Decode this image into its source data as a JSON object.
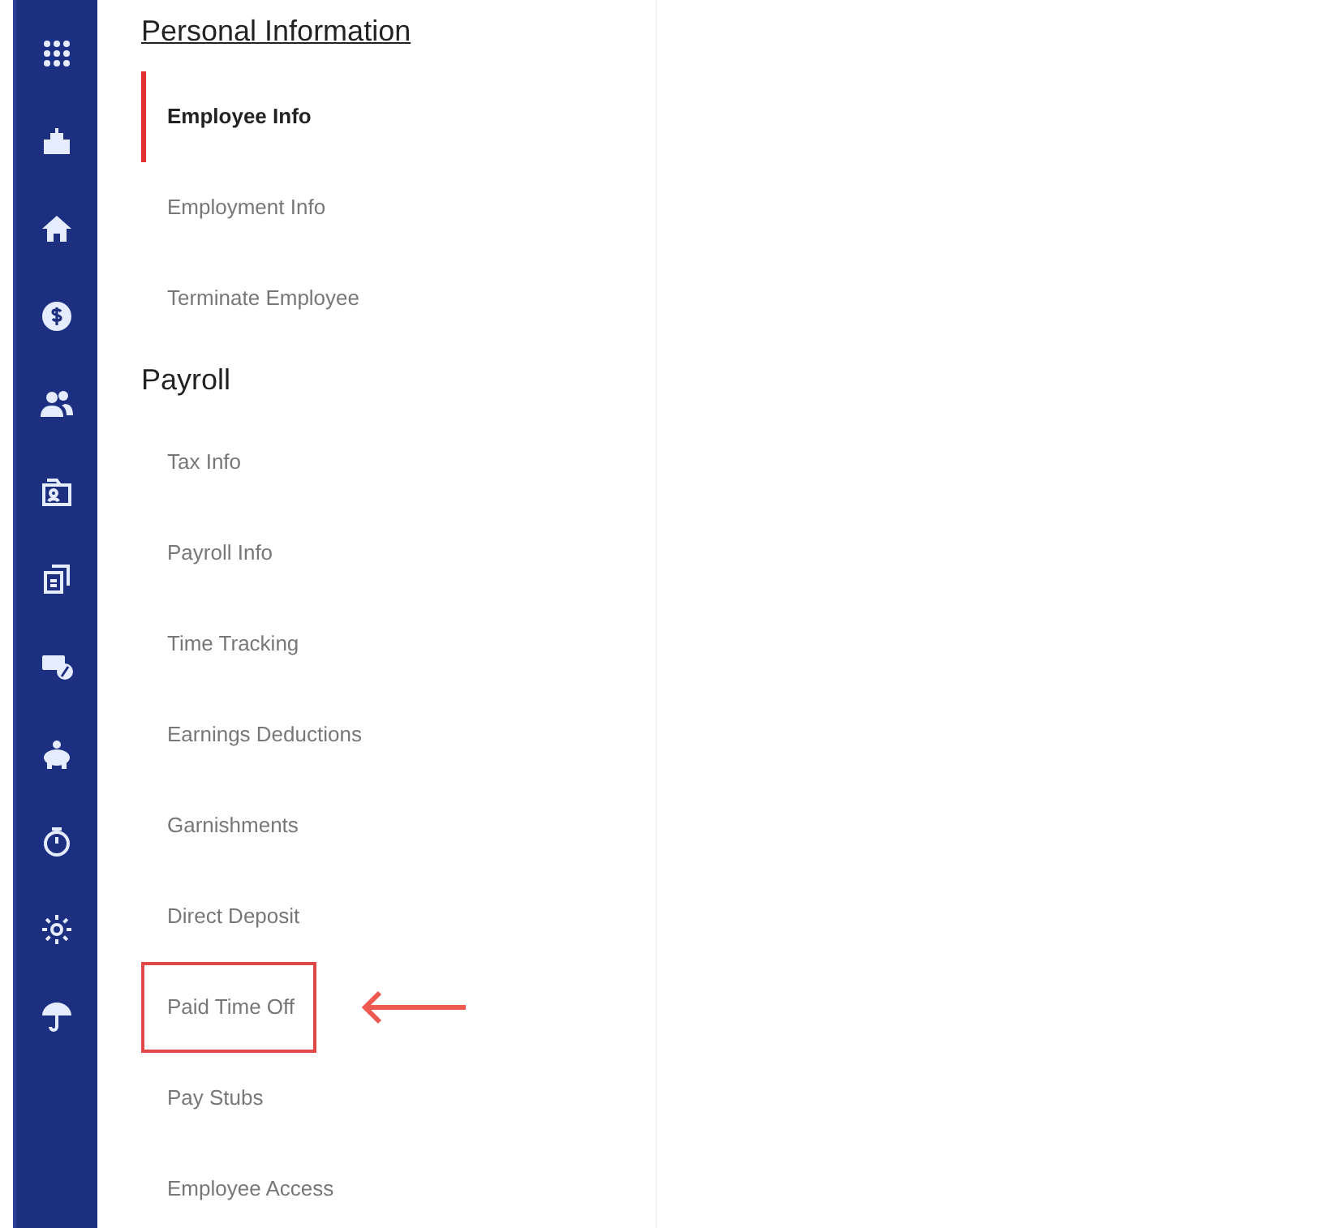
{
  "sections": [
    {
      "heading": "Personal Information",
      "underlined": true,
      "items": [
        {
          "label": "Employee Info",
          "selected": true,
          "highlighted": false
        },
        {
          "label": "Employment Info",
          "selected": false,
          "highlighted": false
        },
        {
          "label": "Terminate Employee",
          "selected": false,
          "highlighted": false
        }
      ]
    },
    {
      "heading": "Payroll",
      "underlined": false,
      "items": [
        {
          "label": "Tax Info",
          "selected": false,
          "highlighted": false
        },
        {
          "label": "Payroll Info",
          "selected": false,
          "highlighted": false
        },
        {
          "label": "Time Tracking",
          "selected": false,
          "highlighted": false
        },
        {
          "label": "Earnings Deductions",
          "selected": false,
          "highlighted": false
        },
        {
          "label": "Garnishments",
          "selected": false,
          "highlighted": false
        },
        {
          "label": "Direct Deposit",
          "selected": false,
          "highlighted": false
        },
        {
          "label": "Paid Time Off",
          "selected": false,
          "highlighted": true
        },
        {
          "label": "Pay Stubs",
          "selected": false,
          "highlighted": false
        },
        {
          "label": "Employee Access",
          "selected": false,
          "highlighted": false
        }
      ]
    }
  ]
}
